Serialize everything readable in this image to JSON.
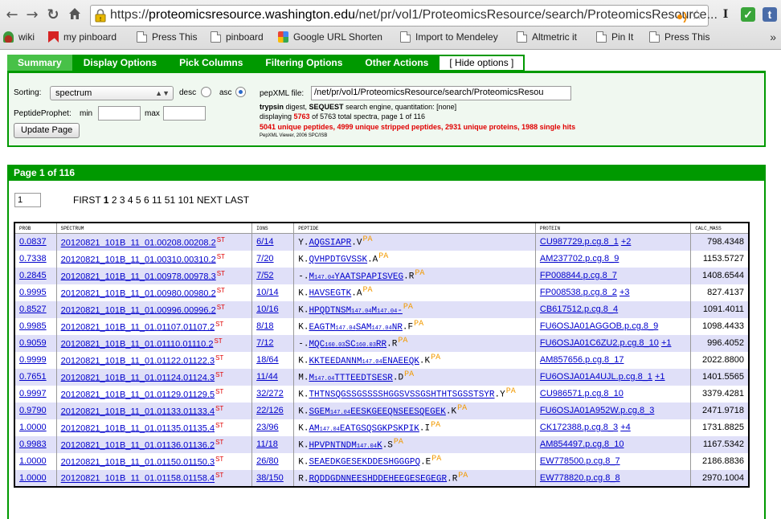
{
  "browser": {
    "url_prefix": "https://",
    "url_host": "proteomicsresource.washington.edu",
    "url_path": "/net/pr/vol1/ProteomicsResource/search/ProteomicsResource...",
    "bookmarks": [
      "wiki",
      "my pinboard",
      "Press This",
      "pinboard",
      "Google URL Shorten",
      "Import to Mendeley",
      "Altmetric it",
      "Pin It",
      "Press This"
    ],
    "more": "»"
  },
  "tabs": [
    "Summary",
    "Display Options",
    "Pick Columns",
    "Filtering Options",
    "Other Actions",
    "[ Hide options ]"
  ],
  "options": {
    "sorting_label": "Sorting:",
    "sorting_value": "spectrum",
    "desc_label": "desc",
    "asc_label": "asc",
    "pp_label": "PeptideProphet:",
    "min_label": "min",
    "max_label": "max",
    "min_value": "",
    "max_value": "",
    "update_button": "Update Page",
    "pepxml_label": "pepXML file:",
    "pepxml_value": "/net/pr/vol1/ProteomicsResource/search/ProteomicsResou",
    "digest_enzyme": "trypsin",
    "digest_text1": " digest, ",
    "digest_engine": "SEQUEST",
    "digest_text2": " search engine, quantitation: [none]",
    "display_prefix": "displaying ",
    "display_count": "5763",
    "display_suffix": " of 5763 total spectra, page 1 of 116",
    "summary_red": "5041 unique peptides, 4999 unique stripped peptides, 2931 unique proteins, 1988 single hits",
    "viewer": "PepXML Viewer, 2006 SPC/ISB"
  },
  "page": {
    "title": "Page 1 of 116",
    "input_value": "1",
    "first": "FIRST",
    "current": "1",
    "pages": [
      "2",
      "3",
      "4",
      "5",
      "6",
      "11",
      "51",
      "101"
    ],
    "next": "NEXT",
    "last": "LAST"
  },
  "table": {
    "headers": [
      "PROB",
      "SPECTRUM",
      "IONS",
      "PEPTIDE",
      "PROTEIN",
      "CALC_MASS"
    ],
    "st_mark": "ST",
    "pa_mark": "PA",
    "rows": [
      {
        "prob": "0.0837",
        "spectrum": "20120821_101B_11_01.00208.00208.2",
        "ions": "6/14",
        "pre": "Y.",
        "pep": [
          [
            "AQGSIAPR",
            false
          ]
        ],
        "post": ".V",
        "protein": "CU987729.p.cg.8_1",
        "extra": "+2",
        "mass": "798.4348"
      },
      {
        "prob": "0.7338",
        "spectrum": "20120821_101B_11_01.00310.00310.2",
        "ions": "7/20",
        "pre": "K.",
        "pep": [
          [
            "QVHPDTGVSSK",
            false
          ]
        ],
        "post": ".A",
        "protein": "AM237702.p.cg.8_9",
        "extra": "",
        "mass": "1153.5727"
      },
      {
        "prob": "0.2845",
        "spectrum": "20120821_101B_11_01.00978.00978.3",
        "ions": "7/52",
        "pre": "-.",
        "pep": [
          [
            "M",
            false
          ],
          [
            "147.04",
            true
          ],
          [
            "YAATSPAPISVEG",
            false
          ]
        ],
        "post": ".R",
        "protein": "FP008844.p.cg.8_7",
        "extra": "",
        "mass": "1408.6544"
      },
      {
        "prob": "0.9995",
        "spectrum": "20120821_101B_11_01.00980.00980.2",
        "ions": "10/14",
        "pre": "K.",
        "pep": [
          [
            "HAVSEGTK",
            false
          ]
        ],
        "post": ".A",
        "protein": "FP008538.p.cg.8_2",
        "extra": "+3",
        "mass": "827.4137"
      },
      {
        "prob": "0.8527",
        "spectrum": "20120821_101B_11_01.00996.00996.2",
        "ions": "10/16",
        "pre": "K.",
        "pep": [
          [
            "HPQDTNSM",
            false
          ],
          [
            "147.04",
            true
          ],
          [
            "M",
            false
          ],
          [
            "147.04",
            true
          ],
          [
            "-",
            false
          ]
        ],
        "post": "",
        "protein": "CB617512.p.cg.8_4",
        "extra": "",
        "mass": "1091.4011"
      },
      {
        "prob": "0.9985",
        "spectrum": "20120821_101B_11_01.01107.01107.2",
        "ions": "8/18",
        "pre": "K.",
        "pep": [
          [
            "EAGTM",
            false
          ],
          [
            "147.04",
            true
          ],
          [
            "SAM",
            false
          ],
          [
            "147.04",
            true
          ],
          [
            "NR",
            false
          ]
        ],
        "post": ".F",
        "protein": "FU6OSJA01AGGOB.p.cg.8_9",
        "extra": "",
        "mass": "1098.4433"
      },
      {
        "prob": "0.9059",
        "spectrum": "20120821_101B_11_01.01110.01110.2",
        "ions": "7/12",
        "pre": "-.",
        "pep": [
          [
            "MQC",
            false
          ],
          [
            "160.03",
            true
          ],
          [
            "SC",
            false
          ],
          [
            "160.03",
            true
          ],
          [
            "RR",
            false
          ]
        ],
        "post": ".R",
        "protein": "FU6OSJA01C6ZU2.p.cg.8_10",
        "extra": "+1",
        "mass": "996.4052"
      },
      {
        "prob": "0.9999",
        "spectrum": "20120821_101B_11_01.01122.01122.3",
        "ions": "18/64",
        "pre": "K.",
        "pep": [
          [
            "KKTEEDANNM",
            false
          ],
          [
            "147.04",
            true
          ],
          [
            "ENAEEQK",
            false
          ]
        ],
        "post": ".K",
        "protein": "AM857656.p.cg.8_17",
        "extra": "",
        "mass": "2022.8800"
      },
      {
        "prob": "0.7651",
        "spectrum": "20120821_101B_11_01.01124.01124.3",
        "ions": "11/44",
        "pre": "M.",
        "pep": [
          [
            "M",
            false
          ],
          [
            "147.04",
            true
          ],
          [
            "TTTEEDTSESR",
            false
          ]
        ],
        "post": ".D",
        "protein": "FU6OSJA01A4UJL.p.cg.8_1",
        "extra": "+1",
        "mass": "1401.5565"
      },
      {
        "prob": "0.9997",
        "spectrum": "20120821_101B_11_01.01129.01129.5",
        "ions": "32/272",
        "pre": "K.",
        "pep": [
          [
            "THTNSQGSSGSSSSHGGSVSSGSHTHTSGSSTSYR",
            false
          ]
        ],
        "post": ".Y",
        "protein": "CU986571.p.cg.8_10",
        "extra": "",
        "mass": "3379.4281"
      },
      {
        "prob": "0.9790",
        "spectrum": "20120821_101B_11_01.01133.01133.4",
        "ions": "22/126",
        "pre": "K.",
        "pep": [
          [
            "SGEM",
            false
          ],
          [
            "147.04",
            true
          ],
          [
            "EESKGEEQNSEESQEGEK",
            false
          ]
        ],
        "post": ".K",
        "protein": "FU6OSJA01A952W.p.cg.8_3",
        "extra": "",
        "mass": "2471.9718"
      },
      {
        "prob": "1.0000",
        "spectrum": "20120821_101B_11_01.01135.01135.4",
        "ions": "23/96",
        "pre": "K.",
        "pep": [
          [
            "AM",
            false
          ],
          [
            "147.04",
            true
          ],
          [
            "EATGSQSGKPSKPIK",
            false
          ]
        ],
        "post": ".I",
        "protein": "CK172388.p.cg.8_3",
        "extra": "+4",
        "mass": "1731.8825"
      },
      {
        "prob": "0.9983",
        "spectrum": "20120821_101B_11_01.01136.01136.2",
        "ions": "11/18",
        "pre": "K.",
        "pep": [
          [
            "HPVPNTNDM",
            false
          ],
          [
            "147.04",
            true
          ],
          [
            "K",
            false
          ]
        ],
        "post": ".S",
        "protein": "AM854497.p.cg.8_10",
        "extra": "",
        "mass": "1167.5342"
      },
      {
        "prob": "1.0000",
        "spectrum": "20120821_101B_11_01.01150.01150.3",
        "ions": "26/80",
        "pre": "K.",
        "pep": [
          [
            "SEAEDKGESEKDDESHGGGPQ",
            false
          ]
        ],
        "post": ".E",
        "protein": "EW778500.p.cg.8_7",
        "extra": "",
        "mass": "2186.8836"
      },
      {
        "prob": "1.0000",
        "spectrum": "20120821_101B_11_01.01158.01158.4",
        "ions": "38/150",
        "pre": "R.",
        "pep": [
          [
            "RQDDGDNNEESHDDEHEEGESEGEGR",
            false
          ]
        ],
        "post": ".R",
        "protein": "EW778820.p.cg.8_8",
        "extra": "",
        "mass": "2970.1004"
      }
    ]
  },
  "colors": {
    "green": "#009900",
    "tab_active": "#48c148",
    "row_alt": "#e0e0f8",
    "link": "#0000cc",
    "alert_red": "#e00000",
    "prophet_orange": "#f29a00"
  }
}
